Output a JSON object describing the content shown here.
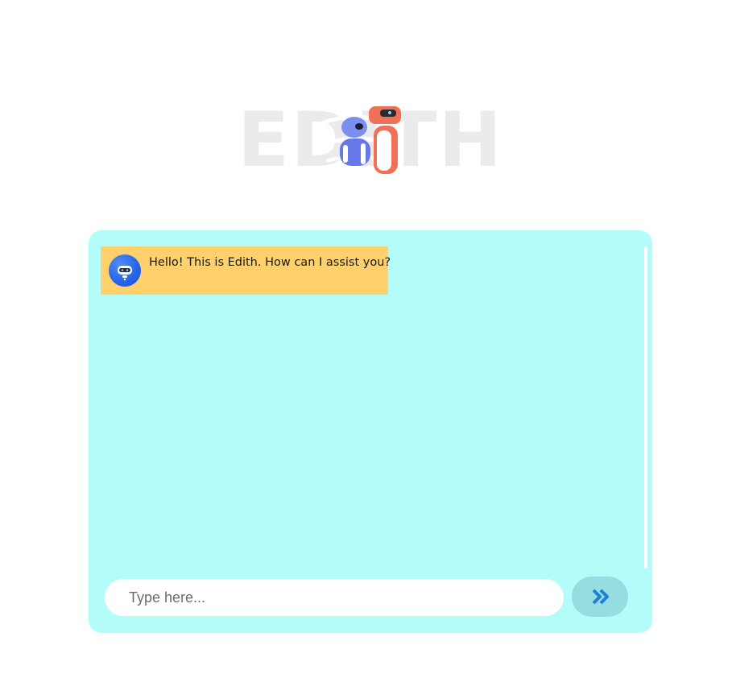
{
  "header": {
    "logo_text": "EDITH"
  },
  "chat": {
    "messages": [
      {
        "sender": "bot",
        "avatar_icon": "robot-icon",
        "text": "Hello! This is Edith. How can I assist you?"
      }
    ]
  },
  "composer": {
    "placeholder": "Type here...",
    "value": "",
    "send_icon": "double-chevron-right-icon"
  },
  "colors": {
    "chat_background": "#b3fcf9",
    "bot_bubble": "#ffd06b",
    "send_button": "#95dde0",
    "send_icon": "#1e7fd6",
    "logo_text": "#ebebeb"
  }
}
